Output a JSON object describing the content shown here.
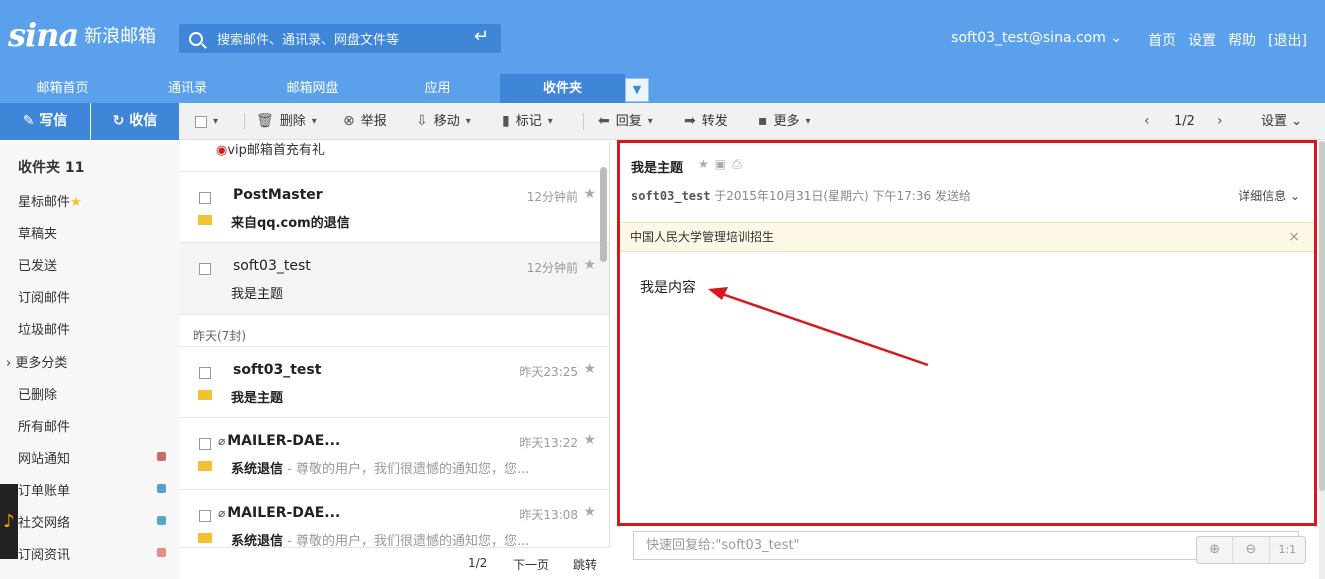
{
  "header": {
    "logo": "sina",
    "brand_name": "新浪邮箱",
    "search_placeholder": "搜索邮件、通讯录、网盘文件等",
    "account": "soft03_test@sina.com ⌄",
    "links": [
      "首页",
      "设置",
      "帮助",
      "[退出]"
    ]
  },
  "tabs": [
    {
      "label": "邮箱首页"
    },
    {
      "label": "通讯录"
    },
    {
      "label": "邮箱网盘"
    },
    {
      "label": "应用"
    },
    {
      "label": "收件夹",
      "active": true
    }
  ],
  "toolbar": {
    "compose": "写信",
    "receive": "收信",
    "delete": "删除",
    "report": "举报",
    "move": "移动",
    "mark": "标记",
    "reply": "回复",
    "forward": "转发",
    "more": "更多",
    "page": "1/2",
    "settings": "设置 ⌄"
  },
  "sidebar": {
    "items": [
      "收件夹 11",
      "星标邮件",
      "草稿夹",
      "已发送",
      "订阅邮件",
      "垃圾邮件",
      "更多分类",
      "已删除",
      "所有邮件",
      "网站通知",
      "订单账单",
      "社交网络",
      "订阅资讯"
    ],
    "dot_colors": [
      "#c96a6a",
      "#5a9dd1",
      "#5aa7c4",
      "#f08a8a"
    ]
  },
  "list": {
    "top_promo": "vip邮箱首充有礼",
    "date_header": "昨天(7封)",
    "mails": [
      {
        "sender": "PostMaster",
        "time": "12分钟前",
        "subject": "来自qq.com的退信",
        "preview": ""
      },
      {
        "sender": "soft03_test",
        "time": "12分钟前",
        "subject": "我是主题",
        "preview": ""
      },
      {
        "sender": "soft03_test",
        "time": "昨天23:25",
        "subject": "我是主题",
        "preview": ""
      },
      {
        "sender": "MAILER-DAE...",
        "time": "昨天13:22",
        "subject": "系统退信",
        "preview": " - 尊敬的用户，我们很遗憾的通知您，您..."
      },
      {
        "sender": "MAILER-DAE...",
        "time": "昨天13:08",
        "subject": "系统退信",
        "preview": " - 尊敬的用户，我们很遗憾的通知您，您..."
      }
    ],
    "footer": {
      "page": "1/2",
      "next": "下一页",
      "jump": "跳转"
    }
  },
  "reader": {
    "title": "我是主题",
    "from": "soft03_test",
    "meta": " 于2015年10月31日(星期六) 下午17:36 发送给",
    "detail": "详细信息 ⌄",
    "ad": "中国人民大学管理培训招生",
    "ad_close": "×",
    "body": "我是内容",
    "quick_reply_placeholder": "快速回复给:\"soft03_test\"",
    "zoom": [
      "⊕",
      "⊖",
      "1:1"
    ]
  },
  "colors": {
    "header": "#5aa0ea",
    "accent": "#3f86d9",
    "highlight_border": "#d9181d"
  }
}
